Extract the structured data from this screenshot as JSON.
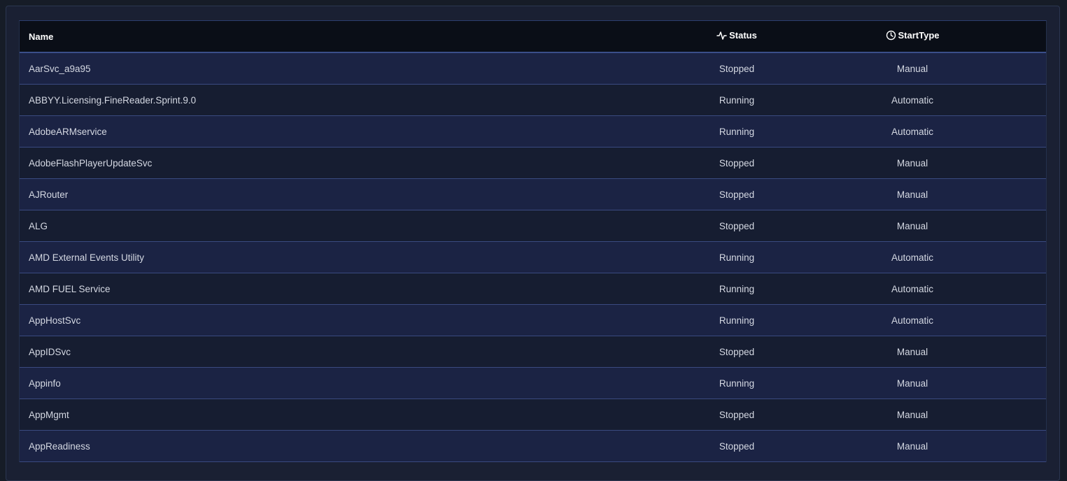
{
  "table": {
    "columns": {
      "name": "Name",
      "status": "Status",
      "start_type": "StartType"
    },
    "header_icons": {
      "status": "activity-icon",
      "start_type": "clock-icon"
    },
    "rows": [
      {
        "name": "AarSvc_a9a95",
        "status": "Stopped",
        "start_type": "Manual"
      },
      {
        "name": "ABBYY.Licensing.FineReader.Sprint.9.0",
        "status": "Running",
        "start_type": "Automatic"
      },
      {
        "name": "AdobeARMservice",
        "status": "Running",
        "start_type": "Automatic"
      },
      {
        "name": "AdobeFlashPlayerUpdateSvc",
        "status": "Stopped",
        "start_type": "Manual"
      },
      {
        "name": "AJRouter",
        "status": "Stopped",
        "start_type": "Manual"
      },
      {
        "name": "ALG",
        "status": "Stopped",
        "start_type": "Manual"
      },
      {
        "name": "AMD External Events Utility",
        "status": "Running",
        "start_type": "Automatic"
      },
      {
        "name": "AMD FUEL Service",
        "status": "Running",
        "start_type": "Automatic"
      },
      {
        "name": "AppHostSvc",
        "status": "Running",
        "start_type": "Automatic"
      },
      {
        "name": "AppIDSvc",
        "status": "Stopped",
        "start_type": "Manual"
      },
      {
        "name": "Appinfo",
        "status": "Running",
        "start_type": "Manual"
      },
      {
        "name": "AppMgmt",
        "status": "Stopped",
        "start_type": "Manual"
      },
      {
        "name": "AppReadiness",
        "status": "Stopped",
        "start_type": "Manual"
      }
    ]
  },
  "colors": {
    "page_bg": "#161c27",
    "header_bg": "#0a0e17",
    "row_odd_bg": "#1b2344",
    "row_even_bg": "#161d31",
    "row_divider": "#3a4a80",
    "text": "#d4d8e2"
  }
}
